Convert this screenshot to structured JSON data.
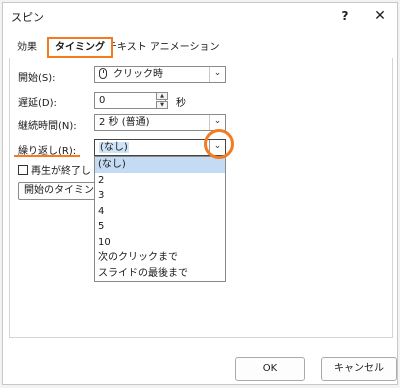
{
  "window": {
    "title": "スピン",
    "help_label": "?",
    "close_label": "✕"
  },
  "tabs": [
    {
      "label": "効果"
    },
    {
      "label": "タイミング"
    },
    {
      "label": "テキスト アニメーション"
    }
  ],
  "form": {
    "start_label": "開始(S):",
    "start_value": "クリック時",
    "delay_label": "遅延(D):",
    "delay_value": "0",
    "delay_unit": "秒",
    "duration_label": "継続時間(N):",
    "duration_value": "2 秒 (普通)",
    "repeat_label": "繰り返し(R):",
    "repeat_value": "(なし)",
    "rewind_label": "再生が終了し",
    "trigger_label": "開始のタイミング"
  },
  "repeat_options": [
    "(なし)",
    "2",
    "3",
    "4",
    "5",
    "10",
    "次のクリックまで",
    "スライドの最後まで"
  ],
  "repeat_selected_index": 0,
  "buttons": {
    "ok": "OK",
    "cancel": "キャンセル"
  },
  "accent_color": "#f47b20"
}
